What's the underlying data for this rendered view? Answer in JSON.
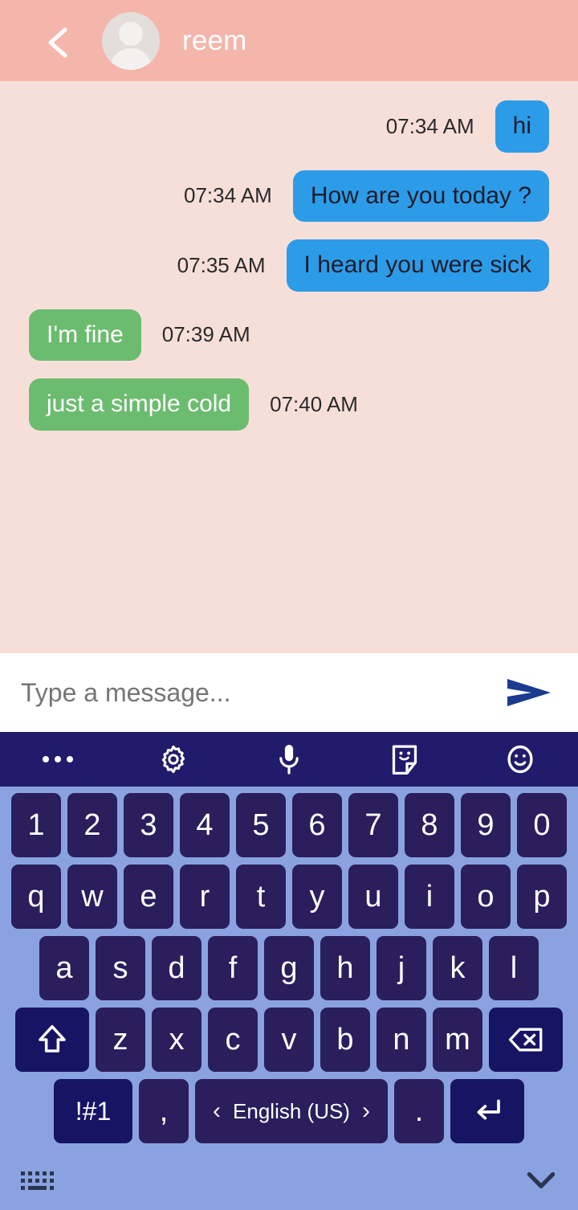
{
  "header": {
    "back_icon": "chevron-left-icon",
    "avatar_icon": "default-avatar-icon",
    "peer_name": "reem",
    "bg_color": "#f4b6ab"
  },
  "chat": {
    "bg_color": "#f7dfd9",
    "outgoing_bubble_color": "#2d9ce8",
    "incoming_bubble_color": "#6cbc70",
    "messages": [
      {
        "text": "hi",
        "time": "07:34 AM",
        "side": "out"
      },
      {
        "text": "How are you today ?",
        "time": "07:34 AM",
        "side": "out"
      },
      {
        "text": "I heard you were sick",
        "time": "07:35 AM",
        "side": "out"
      },
      {
        "text": "I'm fine",
        "time": "07:39 AM",
        "side": "in"
      },
      {
        "text": "just a simple cold",
        "time": "07:40 AM",
        "side": "in"
      }
    ]
  },
  "input_bar": {
    "placeholder": "Type a message...",
    "value": "",
    "send_icon": "send-arrow-icon",
    "send_color": "#1a3b8f"
  },
  "keyboard": {
    "toolbar_bg": "#211b6b",
    "keyboard_bg": "#8aa3e0",
    "key_bg": "#2a1e5c",
    "toolbar": [
      {
        "icon": "more-options-icon",
        "label": ""
      },
      {
        "icon": "gear-icon",
        "label": ""
      },
      {
        "icon": "microphone-icon",
        "label": ""
      },
      {
        "icon": "sticker-icon",
        "label": ""
      },
      {
        "icon": "emoji-icon",
        "label": ""
      }
    ],
    "row_numbers": [
      "1",
      "2",
      "3",
      "4",
      "5",
      "6",
      "7",
      "8",
      "9",
      "0"
    ],
    "row_top": [
      "q",
      "w",
      "e",
      "r",
      "t",
      "y",
      "u",
      "i",
      "o",
      "p"
    ],
    "row_home": [
      "a",
      "s",
      "d",
      "f",
      "g",
      "h",
      "j",
      "k",
      "l"
    ],
    "row_bottom": [
      "z",
      "x",
      "c",
      "v",
      "b",
      "n",
      "m"
    ],
    "shift_key": {
      "icon": "shift-up-arrow-icon",
      "label": ""
    },
    "backspace_key": {
      "icon": "backspace-icon",
      "label": ""
    },
    "symbols_key": {
      "label": "!#1"
    },
    "comma_key": {
      "label": ","
    },
    "period_key": {
      "label": "."
    },
    "enter_key": {
      "icon": "enter-return-icon",
      "label": ""
    },
    "space_key": {
      "language": "English (US)",
      "prev_icon": "chevron-left-icon",
      "next_icon": "chevron-right-icon",
      "prev_label": "‹",
      "next_label": "›"
    },
    "bottom_bar": {
      "keyboard_icon": "keyboard-icon",
      "hide_icon": "chevron-down-icon"
    }
  }
}
